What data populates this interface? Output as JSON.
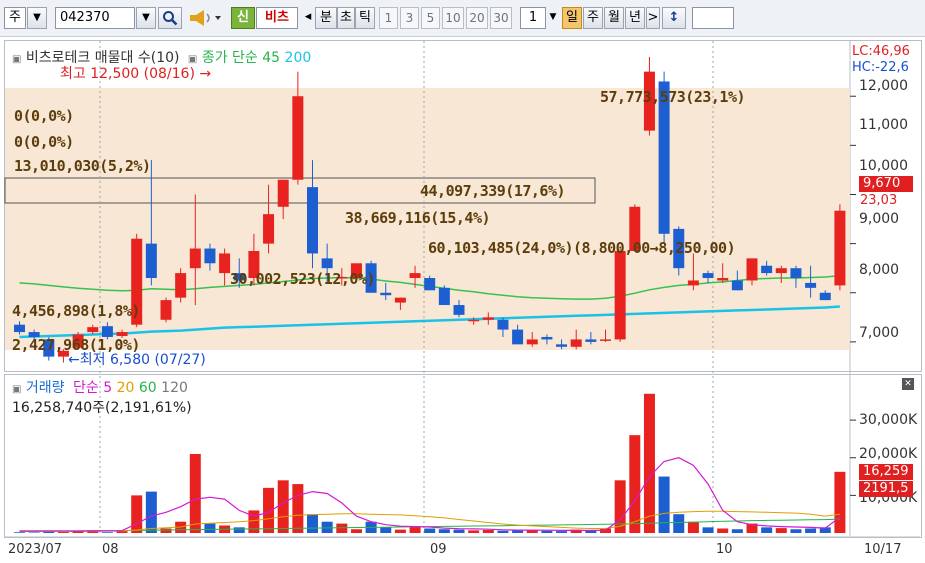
{
  "toolbar": {
    "market": "주",
    "code": "042370",
    "btn_shin": "신",
    "btn_bichu": "비츠",
    "btn_left": "◂",
    "btn_bun": "분",
    "btn_cho": "초",
    "btn_tick": "틱",
    "periods": [
      "1",
      "3",
      "5",
      "10",
      "20",
      "30"
    ],
    "interval": "1",
    "btn_day": "일",
    "btn_week": "주",
    "btn_month": "월",
    "btn_year": "년",
    "btn_right": ">",
    "btn_updown": "↕"
  },
  "price_panel": {
    "legend_name": "비츠로테크 매물대 수(10)",
    "legend_ma_label": "종가 단순",
    "legend_ma1": "45",
    "legend_ma2": "200",
    "lc_label": "LC:46,96",
    "hc_label": "HC:-22,6",
    "high_label": "최고 12,500 (08/16) →",
    "low_label": "←최저 6,580 (07/27)",
    "current_price": "9,670",
    "current_change": "23,03",
    "y_ticks": [
      "12,000",
      "11,000",
      "10,000",
      "9,000",
      "8,000",
      "7,000"
    ],
    "volume_profile": [
      "0(0,0%)",
      "0(0,0%)",
      "13,010,030(5,2%)",
      "44,097,339(17,6%)",
      "38,669,116(15,4%)",
      "60,103,485(24,0%)(8,800,00→8,250,00)",
      "30,002,523(12,0%)",
      "4,456,898(1,8%)",
      "2,427,968(1,0%)",
      "57,773,573(23,1%)"
    ]
  },
  "volume_panel": {
    "legend_name": "거래량",
    "legend_ma_label": "단순",
    "legend_ma1": "5",
    "legend_ma2": "20",
    "legend_ma3": "60",
    "legend_ma4": "120",
    "info": "16,258,740주(2,191,61%)",
    "y_ticks": [
      "30,000K",
      "20,000K",
      "10,000K"
    ],
    "current_vol": "16,259",
    "current_pct": "2191,5"
  },
  "x_axis": [
    "2023/07",
    "08",
    "09",
    "10",
    "10/17"
  ],
  "chart_data": {
    "type": "candlestick",
    "price_ylim": [
      6550,
      12900
    ],
    "candles": [
      [
        7350,
        7420,
        7150,
        7200
      ],
      [
        7200,
        7250,
        7050,
        7100
      ],
      [
        7050,
        7100,
        6620,
        6700
      ],
      [
        6700,
        6850,
        6580,
        6820
      ],
      [
        6880,
        7200,
        6850,
        7150
      ],
      [
        7200,
        7350,
        7150,
        7300
      ],
      [
        7320,
        7400,
        7050,
        7100
      ],
      [
        7120,
        7250,
        7080,
        7200
      ],
      [
        7350,
        9200,
        7300,
        9100
      ],
      [
        9000,
        10700,
        8150,
        8300
      ],
      [
        7450,
        7900,
        7400,
        7850
      ],
      [
        7900,
        8500,
        7800,
        8400
      ],
      [
        8500,
        10000,
        7750,
        8900
      ],
      [
        8900,
        9000,
        8450,
        8600
      ],
      [
        8400,
        8900,
        8150,
        8800
      ],
      [
        8400,
        8700,
        8100,
        8250
      ],
      [
        8300,
        9200,
        8150,
        8850
      ],
      [
        9000,
        10200,
        8800,
        9600
      ],
      [
        9750,
        10300,
        9500,
        10300
      ],
      [
        10300,
        12500,
        10200,
        12000
      ],
      [
        10150,
        10700,
        8500,
        8800
      ],
      [
        8700,
        9000,
        8200,
        8500
      ],
      [
        8300,
        8500,
        8150,
        8320
      ],
      [
        8300,
        8550,
        8250,
        8600
      ],
      [
        8600,
        8650,
        8000,
        8000
      ],
      [
        8000,
        8200,
        7850,
        7950
      ],
      [
        7800,
        7900,
        7650,
        7900
      ],
      [
        8300,
        8550,
        8100,
        8400
      ],
      [
        8300,
        8350,
        8050,
        8050
      ],
      [
        8100,
        8150,
        7750,
        7750
      ],
      [
        7750,
        7850,
        7500,
        7550
      ],
      [
        7450,
        7500,
        7350,
        7450
      ],
      [
        7450,
        7600,
        7350,
        7500
      ],
      [
        7450,
        7500,
        7100,
        7250
      ],
      [
        7250,
        7350,
        6950,
        6950
      ],
      [
        6950,
        7200,
        6900,
        7050
      ],
      [
        7100,
        7150,
        6950,
        7050
      ],
      [
        6950,
        7050,
        6850,
        6900
      ],
      [
        6900,
        7250,
        6850,
        7050
      ],
      [
        7050,
        7200,
        6950,
        7000
      ],
      [
        7050,
        7250,
        7000,
        7050
      ],
      [
        7050,
        8900,
        7000,
        8850
      ],
      [
        8850,
        9800,
        8850,
        9750
      ],
      [
        11300,
        12800,
        11200,
        12500
      ],
      [
        12300,
        12500,
        9000,
        9200
      ],
      [
        9300,
        9350,
        8350,
        8500
      ],
      [
        8150,
        8800,
        8050,
        8250
      ],
      [
        8400,
        8450,
        8200,
        8300
      ],
      [
        8250,
        8600,
        8200,
        8300
      ],
      [
        8250,
        8450,
        8050,
        8050
      ],
      [
        8250,
        8700,
        8150,
        8700
      ],
      [
        8550,
        8650,
        8350,
        8400
      ],
      [
        8400,
        8550,
        8200,
        8500
      ],
      [
        8500,
        8550,
        8100,
        8300
      ],
      [
        8200,
        8550,
        7900,
        8100
      ],
      [
        8000,
        8050,
        7850,
        7850
      ],
      [
        8150,
        9800,
        8050,
        9670
      ]
    ],
    "ma45": [
      8200,
      8180,
      8150,
      8120,
      8090,
      8070,
      8050,
      8040,
      8050,
      8080,
      8070,
      8060,
      8080,
      8110,
      8130,
      8150,
      8170,
      8200,
      8230,
      8260,
      8290,
      8300,
      8310,
      8300,
      8280,
      8240,
      8210,
      8170,
      8130,
      8090,
      8050,
      8020,
      7980,
      7950,
      7920,
      7900,
      7890,
      7880,
      7870,
      7870,
      7890,
      7930,
      7990,
      8060,
      8110,
      8150,
      8170,
      8200,
      8220,
      8250,
      8280,
      8290,
      8300,
      8300,
      8310,
      8320,
      8350
    ],
    "ma200": [
      7100,
      7110,
      7120,
      7130,
      7140,
      7150,
      7160,
      7170,
      7190,
      7210,
      7220,
      7230,
      7250,
      7270,
      7290,
      7300,
      7310,
      7320,
      7330,
      7340,
      7350,
      7360,
      7370,
      7380,
      7390,
      7400,
      7410,
      7420,
      7430,
      7440,
      7450,
      7460,
      7470,
      7480,
      7490,
      7500,
      7510,
      7520,
      7530,
      7540,
      7550,
      7560,
      7570,
      7580,
      7590,
      7600,
      7610,
      7620,
      7630,
      7640,
      7650,
      7660,
      7670,
      7680,
      7690,
      7700,
      7720
    ],
    "volume_ylim": [
      0,
      38000
    ],
    "volumes": [
      200,
      150,
      300,
      250,
      400,
      600,
      200,
      500,
      10000,
      11000,
      1200,
      3000,
      21000,
      2500,
      2000,
      1500,
      6000,
      12000,
      14000,
      13000,
      5000,
      3000,
      2500,
      1000,
      3000,
      1500,
      900,
      1800,
      1200,
      1000,
      900,
      700,
      800,
      600,
      800,
      700,
      600,
      500,
      900,
      700,
      1200,
      14000,
      26000,
      37000,
      15000,
      5000,
      3000,
      1500,
      1200,
      1000,
      2500,
      1500,
      1300,
      1000,
      1200,
      1500,
      16259
    ],
    "vol_ma5": [
      500,
      500,
      520,
      500,
      500,
      550,
      560,
      600,
      2500,
      4500,
      5500,
      7000,
      9000,
      9500,
      9000,
      6000,
      4500,
      5500,
      8000,
      10000,
      11000,
      10500,
      8000,
      4500,
      3000,
      2200,
      1800,
      1700,
      1600,
      1300,
      1150,
      1100,
      1000,
      850,
      780,
      760,
      740,
      700,
      700,
      700,
      780,
      3500,
      8500,
      15000,
      19000,
      20000,
      18000,
      13000,
      6000,
      3000,
      2200,
      1900,
      1700,
      1600,
      1500,
      1300,
      4200
    ],
    "vol_ma20": [
      400,
      420,
      430,
      450,
      470,
      490,
      500,
      520,
      800,
      1200,
      1400,
      1600,
      2400,
      2600,
      2800,
      3000,
      3300,
      3800,
      4300,
      4700,
      4900,
      5000,
      5100,
      5100,
      5000,
      4900,
      4800,
      4600,
      4300,
      4000,
      3600,
      3200,
      2800,
      2400,
      2100,
      1900,
      1700,
      1500,
      1300,
      1200,
      1200,
      1800,
      3000,
      4500,
      5200,
      5500,
      5700,
      5800,
      5800,
      5700,
      5600,
      5500,
      5400,
      5300,
      5000,
      4500,
      5000
    ],
    "vol_ma60": [
      600,
      600,
      610,
      610,
      620,
      630,
      640,
      650,
      700,
      750,
      800,
      850,
      900,
      950,
      1000,
      1050,
      1100,
      1150,
      1200,
      1250,
      1300,
      1350,
      1400,
      1450,
      1500,
      1550,
      1600,
      1650,
      1700,
      1750,
      1800,
      1850,
      1900,
      1950,
      2000,
      2050,
      2100,
      2150,
      2200,
      2250,
      2300,
      2400,
      2500,
      2600,
      2700,
      2800,
      2900,
      3000,
      3100,
      3200,
      3300,
      3350,
      3400,
      3450,
      3500,
      3550,
      3700
    ]
  }
}
